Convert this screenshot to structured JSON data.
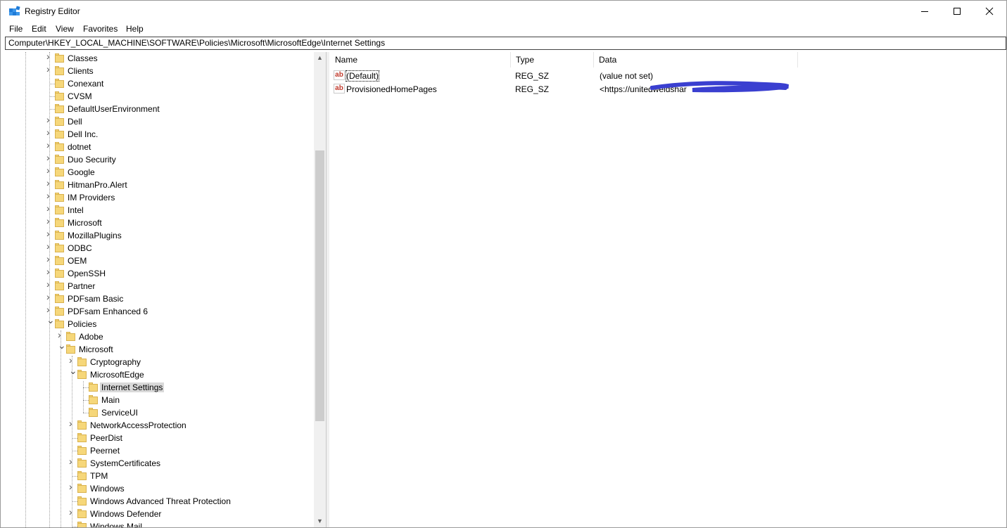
{
  "window": {
    "title": "Registry Editor",
    "controls": {
      "minimize": "minimize",
      "maximize": "maximize",
      "close": "close"
    }
  },
  "menu": [
    "File",
    "Edit",
    "View",
    "Favorites",
    "Help"
  ],
  "address": "Computer\\HKEY_LOCAL_MACHINE\\SOFTWARE\\Policies\\Microsoft\\MicrosoftEdge\\Internet Settings",
  "tree": [
    {
      "label": "Classes",
      "level": 0,
      "expander": "collapsed"
    },
    {
      "label": "Clients",
      "level": 0,
      "expander": "collapsed"
    },
    {
      "label": "Conexant",
      "level": 0,
      "expander": "none"
    },
    {
      "label": "CVSM",
      "level": 0,
      "expander": "none"
    },
    {
      "label": "DefaultUserEnvironment",
      "level": 0,
      "expander": "none"
    },
    {
      "label": "Dell",
      "level": 0,
      "expander": "collapsed"
    },
    {
      "label": "Dell Inc.",
      "level": 0,
      "expander": "collapsed"
    },
    {
      "label": "dotnet",
      "level": 0,
      "expander": "collapsed"
    },
    {
      "label": "Duo Security",
      "level": 0,
      "expander": "collapsed"
    },
    {
      "label": "Google",
      "level": 0,
      "expander": "collapsed"
    },
    {
      "label": "HitmanPro.Alert",
      "level": 0,
      "expander": "collapsed"
    },
    {
      "label": "IM Providers",
      "level": 0,
      "expander": "collapsed"
    },
    {
      "label": "Intel",
      "level": 0,
      "expander": "collapsed"
    },
    {
      "label": "Microsoft",
      "level": 0,
      "expander": "collapsed"
    },
    {
      "label": "MozillaPlugins",
      "level": 0,
      "expander": "collapsed"
    },
    {
      "label": "ODBC",
      "level": 0,
      "expander": "collapsed"
    },
    {
      "label": "OEM",
      "level": 0,
      "expander": "collapsed"
    },
    {
      "label": "OpenSSH",
      "level": 0,
      "expander": "collapsed"
    },
    {
      "label": "Partner",
      "level": 0,
      "expander": "collapsed"
    },
    {
      "label": "PDFsam Basic",
      "level": 0,
      "expander": "collapsed"
    },
    {
      "label": "PDFsam Enhanced 6",
      "level": 0,
      "expander": "collapsed"
    },
    {
      "label": "Policies",
      "level": 0,
      "expander": "expanded"
    },
    {
      "label": "Adobe",
      "level": 1,
      "expander": "collapsed"
    },
    {
      "label": "Microsoft",
      "level": 1,
      "expander": "expanded"
    },
    {
      "label": "Cryptography",
      "level": 2,
      "expander": "collapsed"
    },
    {
      "label": "MicrosoftEdge",
      "level": 2,
      "expander": "expanded"
    },
    {
      "label": "Internet Settings",
      "level": 3,
      "expander": "none",
      "selected": true
    },
    {
      "label": "Main",
      "level": 3,
      "expander": "none"
    },
    {
      "label": "ServiceUI",
      "level": 3,
      "expander": "none"
    },
    {
      "label": "NetworkAccessProtection",
      "level": 2,
      "expander": "collapsed"
    },
    {
      "label": "PeerDist",
      "level": 2,
      "expander": "none"
    },
    {
      "label": "Peernet",
      "level": 2,
      "expander": "none"
    },
    {
      "label": "SystemCertificates",
      "level": 2,
      "expander": "collapsed"
    },
    {
      "label": "TPM",
      "level": 2,
      "expander": "none"
    },
    {
      "label": "Windows",
      "level": 2,
      "expander": "collapsed"
    },
    {
      "label": "Windows Advanced Threat Protection",
      "level": 2,
      "expander": "none"
    },
    {
      "label": "Windows Defender",
      "level": 2,
      "expander": "collapsed"
    },
    {
      "label": "Windows Mail",
      "level": 2,
      "expander": "none"
    }
  ],
  "list": {
    "columns": [
      "Name",
      "Type",
      "Data"
    ],
    "rows": [
      {
        "name": "(Default)",
        "type": "REG_SZ",
        "data": "(value not set)",
        "icon": "string-value-icon",
        "focused": true
      },
      {
        "name": "ProvisionedHomePages",
        "type": "REG_SZ",
        "data": "<https://unitedweldshar",
        "icon": "string-value-icon",
        "redacted": true
      }
    ]
  },
  "colors": {
    "folder": "#f6d77a",
    "selection": "#d9d9d9",
    "redaction": "#3a3fd0",
    "app_icon": "#1e7bd8"
  }
}
